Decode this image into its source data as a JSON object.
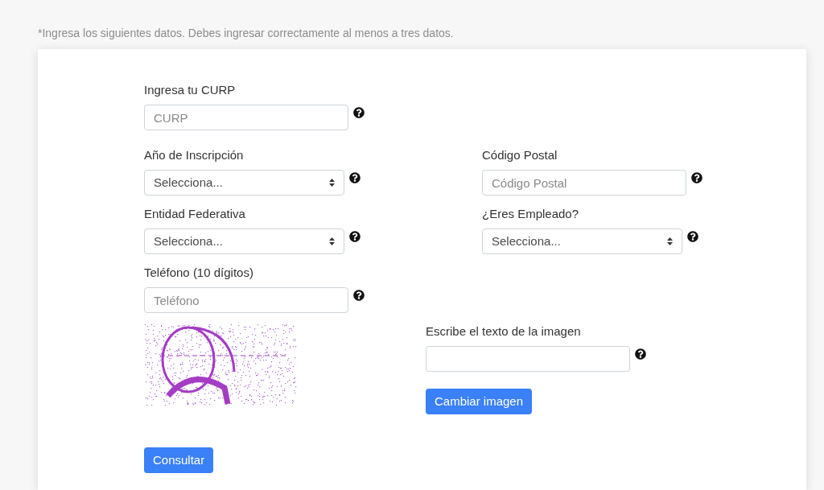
{
  "note": "*Ingresa los siguientes datos. Debes ingresar correctamente al menos a tres datos.",
  "rows": [
    [
      {
        "kind": "text",
        "label": "Ingresa tu CURP",
        "placeholder": "CURP"
      }
    ],
    [
      {
        "kind": "select",
        "label": "Año de Inscripción",
        "value": "Selecciona..."
      },
      {
        "kind": "text",
        "label": "Código Postal",
        "placeholder": "Código Postal"
      }
    ],
    [
      {
        "kind": "select",
        "label": "Entidad Federativa",
        "value": "Selecciona..."
      },
      {
        "kind": "select",
        "label": "¿Eres Empleado?",
        "value": "Selecciona..."
      }
    ],
    [
      {
        "kind": "text",
        "label": "Teléfono (10 dígitos)",
        "placeholder": "Teléfono"
      }
    ]
  ],
  "captcha": {
    "label": "Escribe el texto de la imagen",
    "button": "Cambiar imagen"
  },
  "submit_button": "Consultar"
}
